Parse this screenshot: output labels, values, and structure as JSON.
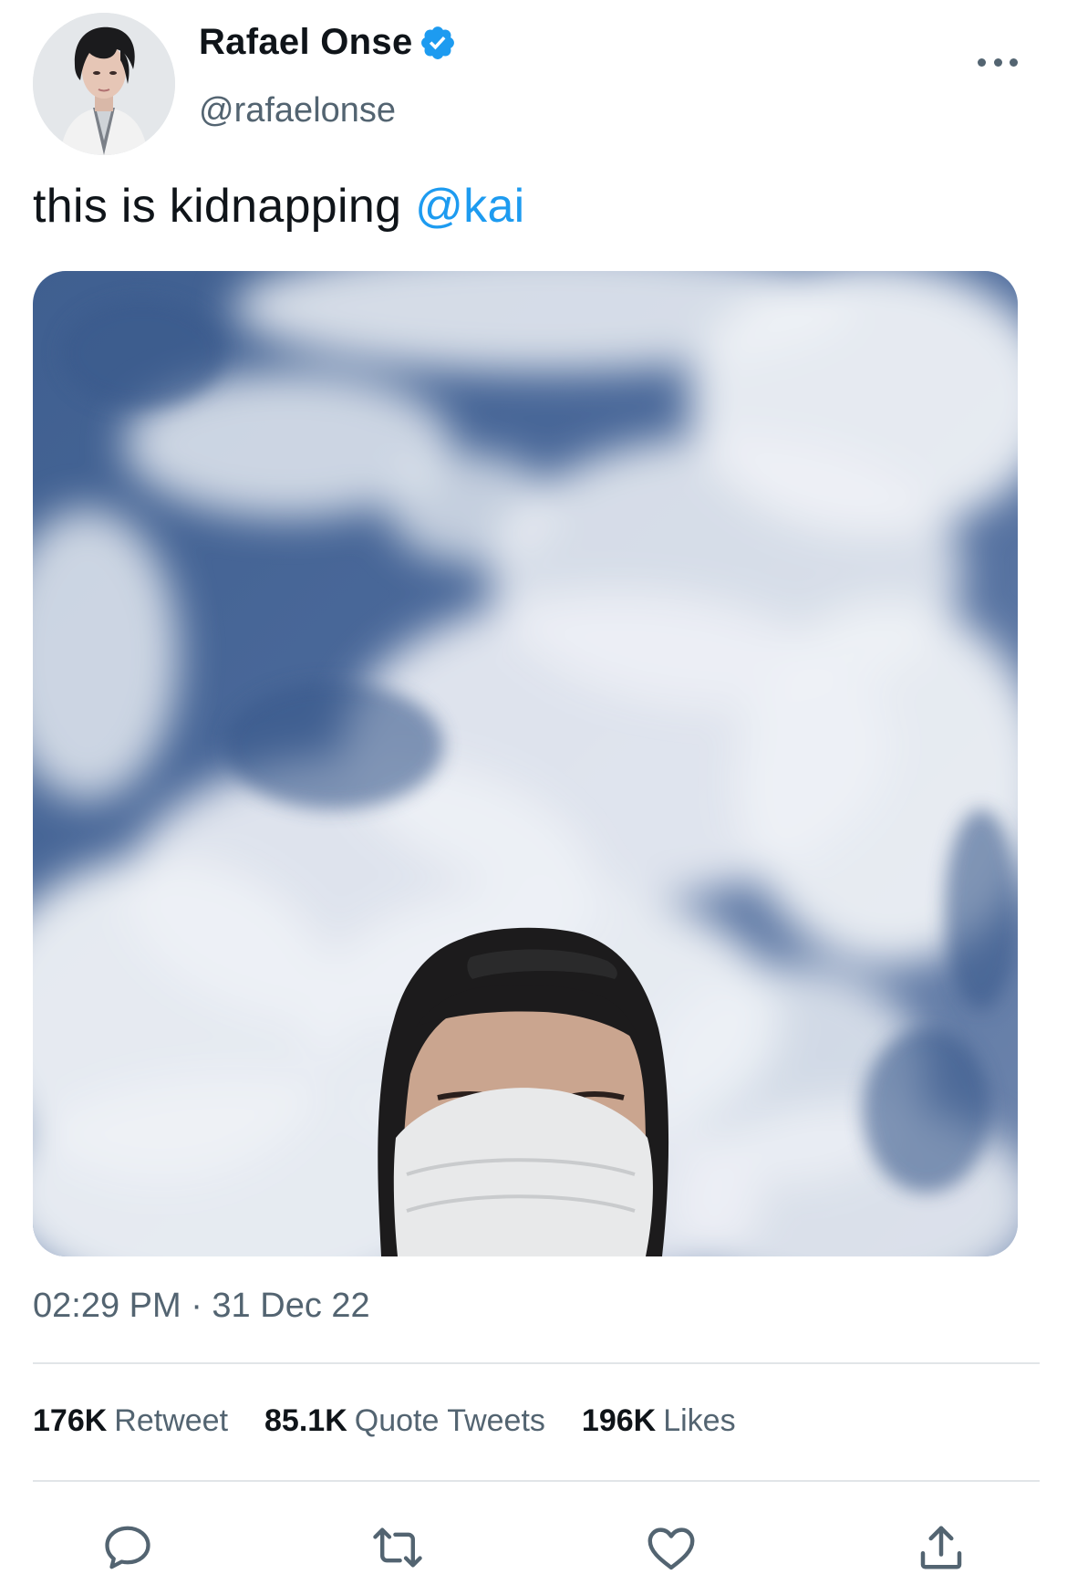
{
  "author": {
    "display_name": "Rafael Onse",
    "handle": "@rafaelonse",
    "verified_icon": "verified-badge-icon"
  },
  "menu": {
    "more_icon": "more-options-icon"
  },
  "tweet": {
    "text": "this is kidnapping ",
    "mention": "@kai",
    "timestamp": "02:29 PM · 31 Dec 22"
  },
  "stats": {
    "retweets_count": "176K",
    "retweets_label": "Retweet",
    "quotes_count": "85.1K",
    "quotes_label": "Quote Tweets",
    "likes_count": "196K",
    "likes_label": "Likes"
  },
  "actions": {
    "reply_icon": "reply-icon",
    "retweet_icon": "retweet-icon",
    "like_icon": "heart-icon",
    "share_icon": "share-icon"
  },
  "colors": {
    "accent": "#1d9bf0",
    "secondary_text": "#536471",
    "primary_text": "#0f1419",
    "divider": "#e1e5e8"
  }
}
